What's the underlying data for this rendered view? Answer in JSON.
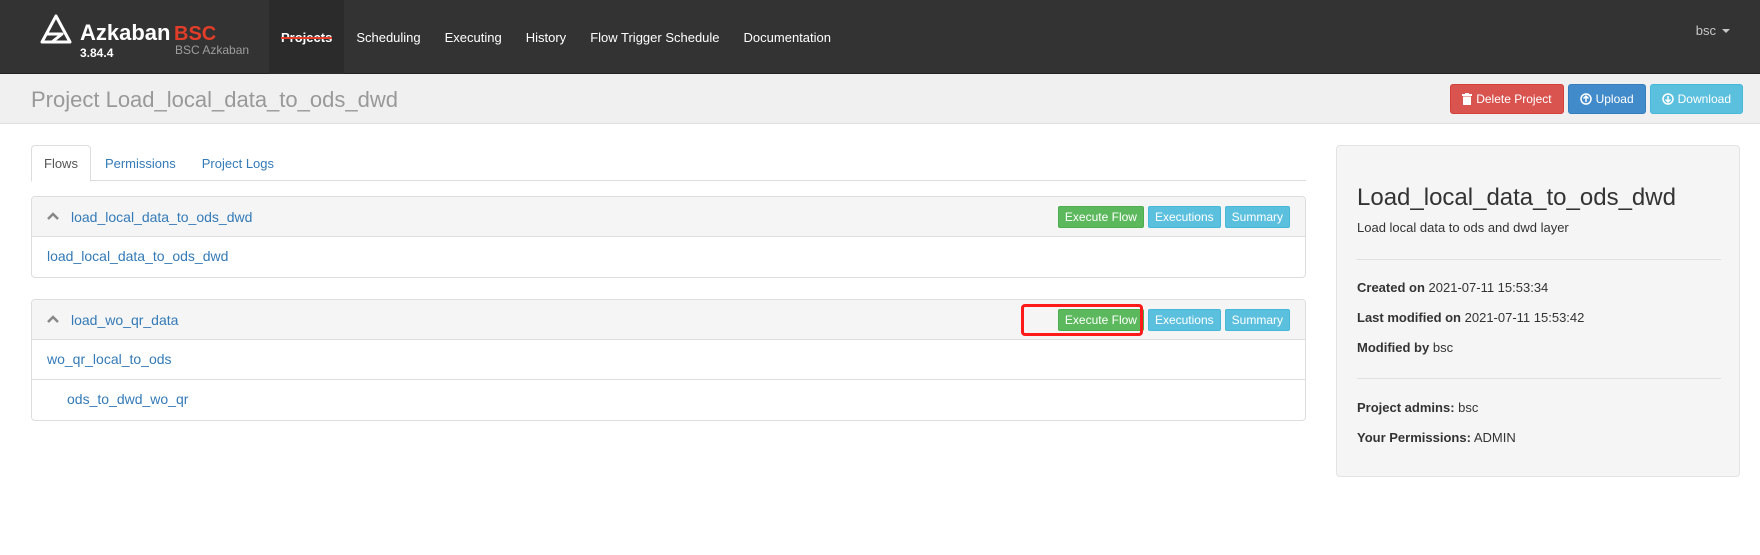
{
  "brand": {
    "name": "Azkaban",
    "suffix": "BSC",
    "version": "3.84.4",
    "subtitle": "BSC Azkaban"
  },
  "nav": {
    "items": [
      {
        "label": "Projects",
        "active": true
      },
      {
        "label": "Scheduling"
      },
      {
        "label": "Executing"
      },
      {
        "label": "History"
      },
      {
        "label": "Flow Trigger Schedule"
      },
      {
        "label": "Documentation"
      }
    ],
    "user": "bsc"
  },
  "project": {
    "title": "Project Load_local_data_to_ods_dwd",
    "buttons": {
      "delete": "Delete Project",
      "upload": "Upload",
      "download": "Download"
    }
  },
  "tabs": [
    {
      "label": "Flows",
      "active": true
    },
    {
      "label": "Permissions"
    },
    {
      "label": "Project Logs"
    }
  ],
  "flow_buttons": {
    "execute": "Execute Flow",
    "executions": "Executions",
    "summary": "Summary"
  },
  "flows": [
    {
      "name": "load_local_data_to_ods_dwd",
      "jobs": [
        {
          "name": "load_local_data_to_ods_dwd",
          "indent": 0
        }
      ]
    },
    {
      "name": "load_wo_qr_data",
      "jobs": [
        {
          "name": "wo_qr_local_to_ods",
          "indent": 0
        },
        {
          "name": "ods_to_dwd_wo_qr",
          "indent": 1
        }
      ]
    }
  ],
  "info": {
    "title": "Load_local_data_to_ods_dwd",
    "description": "Load local data to ods and dwd layer",
    "created_label": "Created on",
    "created_value": "2021-07-11 15:53:34",
    "modified_label": "Last modified on",
    "modified_value": "2021-07-11 15:53:42",
    "modified_by_label": "Modified by",
    "modified_by_value": "bsc",
    "admins_label": "Project admins:",
    "admins_value": "bsc",
    "permissions_label": "Your Permissions:",
    "permissions_value": "ADMIN"
  },
  "colors": {
    "navbar": "#333333",
    "accent": "#e23d28",
    "link": "#337ab7",
    "success": "#5cb85c",
    "info": "#5bc0de",
    "danger": "#d9534f",
    "primary": "#428bca",
    "highlight": "#ff1a1a"
  }
}
